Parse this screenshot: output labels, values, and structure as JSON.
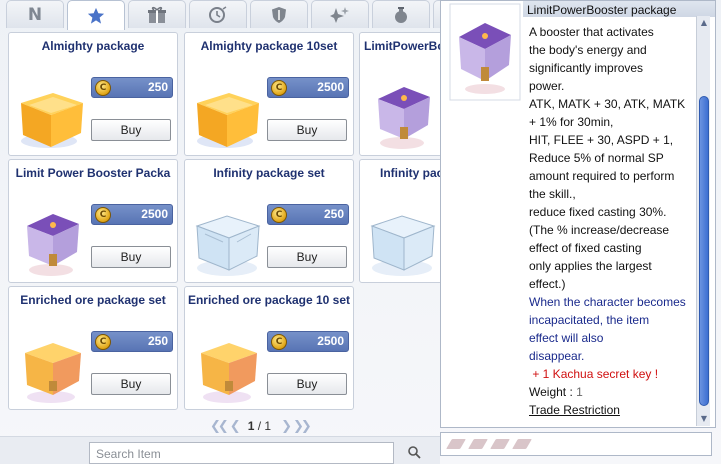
{
  "tabs": [
    {
      "label": "N",
      "icon": "n-letter"
    },
    {
      "label": "",
      "icon": "star-icon"
    },
    {
      "label": "",
      "icon": "gift-box-icon"
    },
    {
      "label": "",
      "icon": "clock-icon"
    },
    {
      "label": "",
      "icon": "shield-icon"
    },
    {
      "label": "",
      "icon": "sparkle-icon"
    },
    {
      "label": "",
      "icon": "potion-icon"
    },
    {
      "label": "",
      "icon": "more-icon"
    }
  ],
  "items": [
    {
      "name": "Almighty package",
      "price": "250",
      "buy": "Buy",
      "icon": "orange-box"
    },
    {
      "name": "Almighty package 10set",
      "price": "2500",
      "buy": "Buy",
      "icon": "orange-box"
    },
    {
      "name": "LimitPowerBo",
      "price": "",
      "buy": "",
      "icon": "purple-box"
    },
    {
      "name": "Limit Power Booster Packa",
      "price": "2500",
      "buy": "Buy",
      "icon": "purple-box"
    },
    {
      "name": "Infinity package set",
      "price": "250",
      "buy": "Buy",
      "icon": "ice-box"
    },
    {
      "name": "Infinity pac",
      "price": "",
      "buy": "",
      "icon": "ice-box"
    },
    {
      "name": "Enriched ore package set",
      "price": "250",
      "buy": "Buy",
      "icon": "ore-box"
    },
    {
      "name": "Enriched ore package 10 set",
      "price": "2500",
      "buy": "Buy",
      "icon": "ore-box"
    }
  ],
  "pager": {
    "current": "1",
    "total": "1"
  },
  "search": {
    "placeholder": "Search Item"
  },
  "tooltip": {
    "title": "LimitPowerBooster package",
    "lines": [
      "A booster that activates",
      "the body's energy and",
      "significantly improves",
      "power.",
      "ATK, MATK + 30, ATK, MATK",
      "+ 1% for 30min,",
      "HIT, FLEE + 30, ASPD + 1,",
      "Reduce 5% of normal SP",
      "amount required to perform",
      "the skill.,",
      "reduce fixed casting 30%.",
      "(The % increase/decrease",
      "effect of fixed casting",
      "only applies the largest",
      "effect.)"
    ],
    "blue_lines": [
      "When the character becomes",
      "incapacitated, the item",
      "effect will also",
      "disappear."
    ],
    "red_line": " + 1 Kachua secret key !",
    "weight_label": "Weight : ",
    "weight_value": "1",
    "trade": "Trade Restriction"
  },
  "colors": {
    "title_navy": "#1f3170",
    "price_blue": "#5874b4",
    "red": "#d01010",
    "blue_text": "#1a2a8c"
  }
}
